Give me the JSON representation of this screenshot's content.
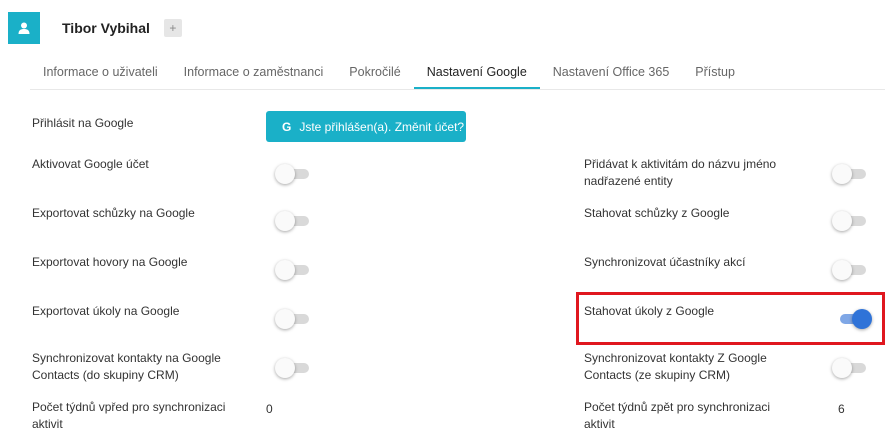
{
  "user": {
    "name": "Tibor Vybihal",
    "add_label": "+"
  },
  "tabs": [
    {
      "label": "Informace o uživateli"
    },
    {
      "label": "Informace o zaměstnanci"
    },
    {
      "label": "Pokročilé"
    },
    {
      "label": "Nastavení Google",
      "active": true
    },
    {
      "label": "Nastavení Office 365"
    },
    {
      "label": "Přístup"
    }
  ],
  "login": {
    "label": "Přihlásit na Google",
    "button_icon": "G",
    "button_label": "Jste přihlášen(a). Změnit účet?"
  },
  "left_settings": [
    {
      "label": "Aktivovat Google účet",
      "enabled": false
    },
    {
      "label": "Exportovat schůzky na Google",
      "enabled": false
    },
    {
      "label": "Exportovat hovory na Google",
      "enabled": false
    },
    {
      "label": "Exportovat úkoly na Google",
      "enabled": false
    },
    {
      "label": "Synchronizovat kontakty na Google Contacts (do skupiny CRM)",
      "enabled": false
    }
  ],
  "right_settings": [
    {
      "label": "Přidávat k aktivitám do názvu jméno nadřazené entity",
      "enabled": false
    },
    {
      "label": "Stahovat schůzky z Google",
      "enabled": false
    },
    {
      "label": "Synchronizovat účastníky akcí",
      "enabled": false
    },
    {
      "label": "Stahovat úkoly z Google",
      "enabled": true
    },
    {
      "label": "Synchronizovat kontakty Z Google Contacts (ze skupiny CRM)",
      "enabled": false
    }
  ],
  "weeks_forward": {
    "label": "Počet týdnů vpřed pro synchronizaci aktivit",
    "value": "0"
  },
  "weeks_back": {
    "label": "Počet týdnů zpět pro synchronizaci aktivit",
    "value": "6"
  },
  "colors": {
    "accent": "#1ab0c8",
    "toggle_on": "#2f73d8",
    "highlight": "#e0171f"
  }
}
